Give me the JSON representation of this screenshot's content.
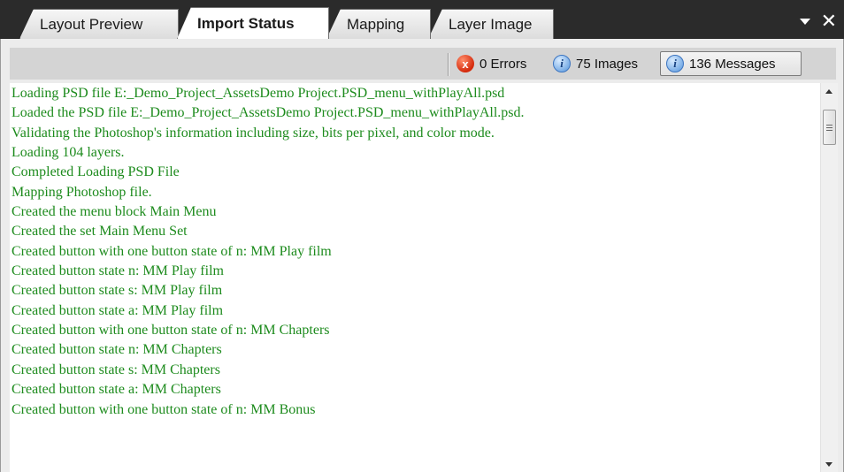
{
  "tabs": [
    {
      "label": "Layout Preview",
      "active": false
    },
    {
      "label": "Import Status",
      "active": true
    },
    {
      "label": "Mapping",
      "active": false
    },
    {
      "label": "Layer Image",
      "active": false
    }
  ],
  "window_controls": {
    "pin_icon": "dropdown-arrow-icon",
    "close_label": "✕"
  },
  "filters": {
    "errors": {
      "icon_glyph": "x",
      "label": "0 Errors",
      "icon": "error-icon"
    },
    "images": {
      "icon_glyph": "i",
      "label": "75 Images",
      "icon": "info-icon"
    },
    "messages": {
      "icon_glyph": "i",
      "label": "136 Messages",
      "icon": "info-icon",
      "selected": true
    }
  },
  "log": [
    "Loading PSD file E:_Demo_Project_AssetsDemo Project.PSD_menu_withPlayAll.psd",
    "Loaded the PSD file E:_Demo_Project_AssetsDemo Project.PSD_menu_withPlayAll.psd.",
    "Validating the Photoshop's information including size, bits per pixel, and color mode.",
    "Loading 104 layers.",
    "Completed Loading PSD File",
    "Mapping Photoshop file.",
    "Created the menu block Main Menu",
    "Created the set Main Menu Set",
    "Created button with one button state of n: MM Play film",
    "Created button state n: MM Play film",
    "Created button state s: MM Play film",
    "Created button state a: MM Play film",
    "Created button with one button state of n: MM Chapters",
    "Created button state n: MM Chapters",
    "Created button state s: MM Chapters",
    "Created button state a: MM Chapters",
    "Created button with one button state of n: MM Bonus"
  ],
  "colors": {
    "log_text": "#1d8b1d",
    "tab_strip": "#2b2b2b",
    "panel": "#ececec",
    "toolbar": "#d4d4d4"
  }
}
